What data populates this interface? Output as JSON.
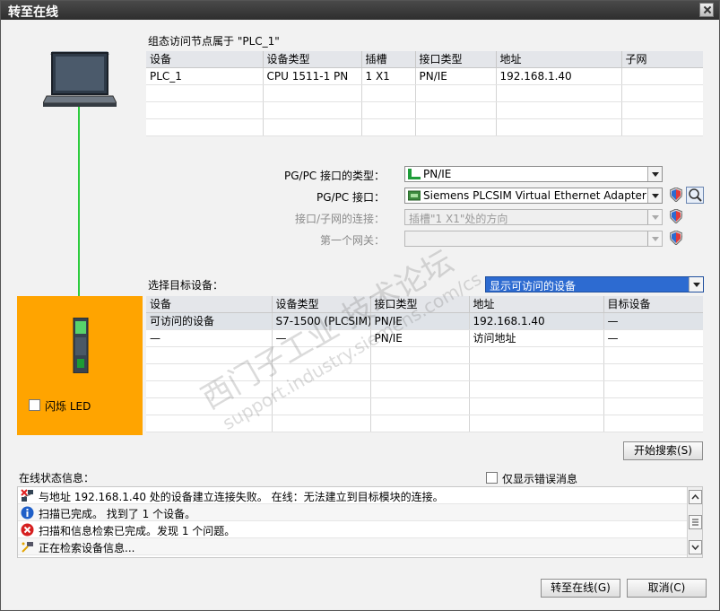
{
  "window": {
    "title": "转至在线"
  },
  "top": {
    "caption": "组态访问节点属于 \"PLC_1\"",
    "columns": [
      "设备",
      "设备类型",
      "插槽",
      "接口类型",
      "地址",
      "子网"
    ],
    "row": [
      "PLC_1",
      "CPU 1511-1 PN",
      "1 X1",
      "PN/IE",
      "192.168.1.40",
      ""
    ]
  },
  "settings": {
    "pgpc_type_label": "PG/PC 接口的类型：",
    "pgpc_type_value": "PN/IE",
    "pgpc_iface_label": "PG/PC 接口：",
    "pgpc_iface_value": "Siemens PLCSIM Virtual Ethernet Adapter",
    "subnet_label": "接口/子网的连接：",
    "subnet_value": "插槽\"1 X1\"处的方向",
    "gateway_label": "第一个网关：",
    "gateway_value": ""
  },
  "target": {
    "caption": "选择目标设备：",
    "filter_value": "显示可访问的设备",
    "columns": [
      "设备",
      "设备类型",
      "接口类型",
      "地址",
      "目标设备"
    ],
    "rows": [
      [
        "可访问的设备",
        "S7-1500 (PLCSIM)",
        "PN/IE",
        "192.168.1.40",
        "—"
      ],
      [
        "—",
        "—",
        "PN/IE",
        "访问地址",
        "—"
      ]
    ]
  },
  "flash_led_label": "闪烁 LED",
  "start_search_label": "开始搜索(S)",
  "status": {
    "caption": "在线状态信息：",
    "errors_only_label": "仅显示错误消息",
    "messages": [
      {
        "icon": "connection-error-icon",
        "text": "与地址 192.168.1.40 处的设备建立连接失败。 在线：无法建立到目标模块的连接。"
      },
      {
        "icon": "info-icon",
        "text": "扫描已完成。 找到了 1 个设备。"
      },
      {
        "icon": "error-icon",
        "text": "扫描和信息检索已完成。发现 1 个问题。"
      },
      {
        "icon": "searching-icon",
        "text": "正在检索设备信息..."
      }
    ]
  },
  "buttons": {
    "go_online": "转至在线(G)",
    "cancel": "取消(C)"
  },
  "watermark": {
    "line1": "西门子工业 技术论坛",
    "line2": "support.industry.siemens.com/cs"
  }
}
